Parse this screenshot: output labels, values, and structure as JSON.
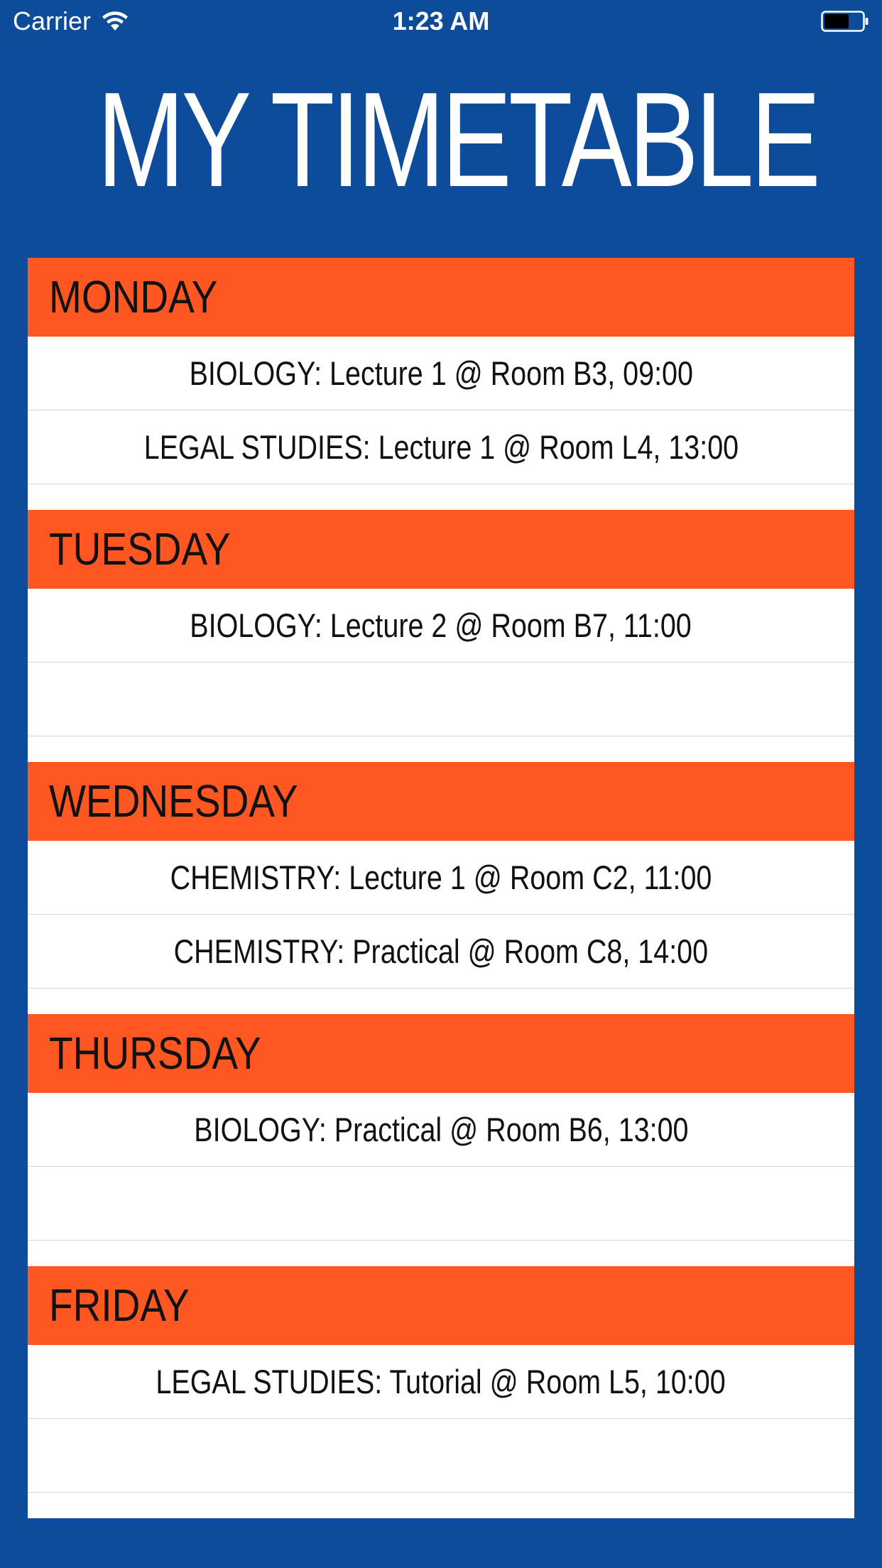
{
  "status_bar": {
    "carrier": "Carrier",
    "time": "1:23 AM"
  },
  "title": "MY TIMETABLE",
  "colors": {
    "background": "#0D4B9B",
    "day_header": "#FE5722",
    "row_background": "#FFFFFF"
  },
  "days": [
    {
      "name": "MONDAY",
      "slots": [
        "BIOLOGY: Lecture 1 @ Room B3, 09:00",
        "LEGAL STUDIES: Lecture 1 @ Room L4, 13:00"
      ]
    },
    {
      "name": "TUESDAY",
      "slots": [
        "BIOLOGY: Lecture 2 @ Room B7, 11:00",
        ""
      ]
    },
    {
      "name": "WEDNESDAY",
      "slots": [
        "CHEMISTRY: Lecture 1 @ Room C2, 11:00",
        "CHEMISTRY: Practical  @ Room C8, 14:00"
      ]
    },
    {
      "name": "THURSDAY",
      "slots": [
        "BIOLOGY: Practical @ Room B6, 13:00",
        ""
      ]
    },
    {
      "name": "FRIDAY",
      "slots": [
        "LEGAL STUDIES: Tutorial @ Room L5, 10:00",
        ""
      ]
    }
  ]
}
